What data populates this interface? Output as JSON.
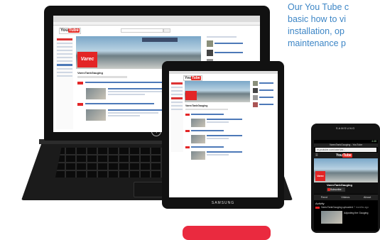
{
  "caption": {
    "lines": [
      "Our You Tube c",
      "basic how to vi",
      "installation, op",
      "maintenance p"
    ]
  },
  "colors": {
    "caption_text": "#3d86c6",
    "brand_red": "#e32526",
    "button_red": "#ea2a3f",
    "device_black": "#111111"
  },
  "laptop": {
    "brand": "hp",
    "screen": {
      "logo_word": "Tube",
      "logo_prefix": "You",
      "varec_logo": "Varec",
      "channel_name": "VarecTankGauging"
    }
  },
  "tablet": {
    "brand": "SAMSUNG",
    "screen": {
      "logo_word": "Tube",
      "logo_prefix": "You",
      "channel_name": "VarecTankGauging"
    }
  },
  "phone": {
    "brand": "SAMSUNG",
    "status_time": "4:48",
    "screen": {
      "title_bar": "VarecTankGauging - YouTube",
      "url": "m.youtube.com/user/var...",
      "logo_prefix": "You",
      "logo_word": "Tube",
      "varec_logo": "Varec",
      "channel_name": "VarecTankGauging",
      "subscribe_label": "Subscribe",
      "tabs": [
        "Feed",
        "Videos",
        "About"
      ],
      "activity_label": "Activity",
      "activity_item": "VarecTankGauging uploaded",
      "activity_time": "7 months ago",
      "video_title": "Adjusting the Gauging"
    }
  }
}
